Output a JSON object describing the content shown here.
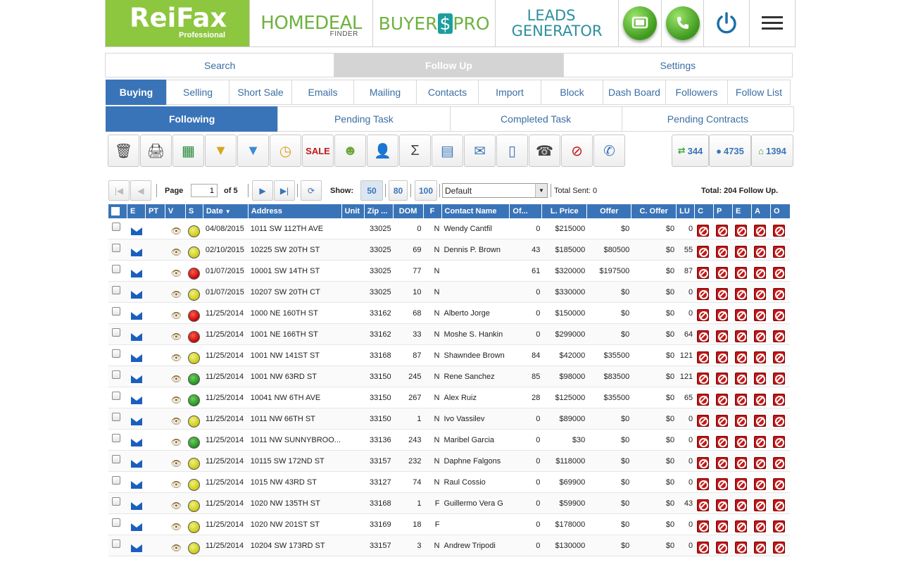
{
  "header": {
    "logo_brand": "ReiFax",
    "logo_sub": "Professional",
    "homedeal": "HOMEDEAL",
    "homedeal_sub": "FINDER",
    "buyerspro_a": "BUYER",
    "buyerspro_s": "$",
    "buyerspro_b": "PRO",
    "leads_1": "LEADS",
    "leads_2": "GENERATOR"
  },
  "main_tabs": [
    "Search",
    "Follow Up",
    "Settings"
  ],
  "sub_tabs": [
    "Buying",
    "Selling",
    "Short Sale",
    "Emails",
    "Mailing",
    "Contacts",
    "Import",
    "Block",
    "Dash Board",
    "Followers",
    "Follow List"
  ],
  "task_tabs": [
    "Following",
    "Pending Task",
    "Completed Task",
    "Pending Contracts"
  ],
  "stats": {
    "a": "344",
    "b": "4735",
    "c": "1394"
  },
  "pager": {
    "page_label": "Page",
    "page_value": "1",
    "of_label": "of 5",
    "show_label": "Show:",
    "show_options": [
      "50",
      "80",
      "100"
    ],
    "filter_value": "Default",
    "total_sent": "Total Sent: 0",
    "total": "Total: 204 Follow Up."
  },
  "columns": [
    "E",
    "PT",
    "V",
    "S",
    "Date",
    "Address",
    "Unit",
    "Zip ...",
    "DOM",
    "F",
    "Contact Name",
    "Of...",
    "L. Price",
    "Offer",
    "C. Offer",
    "LU",
    "C",
    "P",
    "E",
    "A",
    "O"
  ],
  "rows": [
    {
      "status": "yellow",
      "date": "04/08/2015",
      "address": "1011 SW 112TH AVE",
      "unit": "",
      "zip": "33025",
      "dom": "0",
      "f": "N",
      "contact": "Wendy Cantfil",
      "of": "0",
      "lprice": "$215000",
      "offer": "$0",
      "coffer": "$0",
      "lu": "0"
    },
    {
      "status": "yellow",
      "date": "02/10/2015",
      "address": "10225 SW 20TH ST",
      "unit": "",
      "zip": "33025",
      "dom": "69",
      "f": "N",
      "contact": "Dennis P. Brown",
      "of": "43",
      "lprice": "$185000",
      "offer": "$80500",
      "coffer": "$0",
      "lu": "55"
    },
    {
      "status": "red",
      "date": "01/07/2015",
      "address": "10001 SW 14TH ST",
      "unit": "",
      "zip": "33025",
      "dom": "77",
      "f": "N",
      "contact": "",
      "of": "61",
      "lprice": "$320000",
      "offer": "$197500",
      "coffer": "$0",
      "lu": "87"
    },
    {
      "status": "yellow",
      "date": "01/07/2015",
      "address": "10207 SW 20TH CT",
      "unit": "",
      "zip": "33025",
      "dom": "10",
      "f": "N",
      "contact": "",
      "of": "0",
      "lprice": "$330000",
      "offer": "$0",
      "coffer": "$0",
      "lu": "0"
    },
    {
      "status": "red",
      "date": "11/25/2014",
      "address": "1000 NE 160TH ST",
      "unit": "",
      "zip": "33162",
      "dom": "68",
      "f": "N",
      "contact": "Alberto Jorge",
      "of": "0",
      "lprice": "$150000",
      "offer": "$0",
      "coffer": "$0",
      "lu": "0"
    },
    {
      "status": "red",
      "date": "11/25/2014",
      "address": "1001 NE 166TH ST",
      "unit": "",
      "zip": "33162",
      "dom": "33",
      "f": "N",
      "contact": "Moshe S. Hankin",
      "of": "0",
      "lprice": "$299000",
      "offer": "$0",
      "coffer": "$0",
      "lu": "64"
    },
    {
      "status": "yellow",
      "date": "11/25/2014",
      "address": "1001 NW 141ST ST",
      "unit": "",
      "zip": "33168",
      "dom": "87",
      "f": "N",
      "contact": "Shawndee Brown",
      "of": "84",
      "lprice": "$42000",
      "offer": "$35500",
      "coffer": "$0",
      "lu": "121"
    },
    {
      "status": "green",
      "date": "11/25/2014",
      "address": "1001 NW 63RD ST",
      "unit": "",
      "zip": "33150",
      "dom": "245",
      "f": "N",
      "contact": "Rene Sanchez",
      "of": "85",
      "lprice": "$98000",
      "offer": "$83500",
      "coffer": "$0",
      "lu": "121"
    },
    {
      "status": "green",
      "date": "11/25/2014",
      "address": "10041 NW 6TH AVE",
      "unit": "",
      "zip": "33150",
      "dom": "267",
      "f": "N",
      "contact": "Alex Ruiz",
      "of": "28",
      "lprice": "$125000",
      "offer": "$35500",
      "coffer": "$0",
      "lu": "65"
    },
    {
      "status": "yellow",
      "date": "11/25/2014",
      "address": "1011 NW 66TH ST",
      "unit": "",
      "zip": "33150",
      "dom": "1",
      "f": "N",
      "contact": "Ivo Vassilev",
      "of": "0",
      "lprice": "$89000",
      "offer": "$0",
      "coffer": "$0",
      "lu": "0"
    },
    {
      "status": "green",
      "date": "11/25/2014",
      "address": "1011 NW SUNNYBROO...",
      "unit": "",
      "zip": "33136",
      "dom": "243",
      "f": "N",
      "contact": "Maribel Garcia",
      "of": "0",
      "lprice": "$30",
      "offer": "$0",
      "coffer": "$0",
      "lu": "0"
    },
    {
      "status": "yellow",
      "date": "11/25/2014",
      "address": "10115 SW 172ND ST",
      "unit": "",
      "zip": "33157",
      "dom": "232",
      "f": "N",
      "contact": "Daphne Falgons",
      "of": "0",
      "lprice": "$118000",
      "offer": "$0",
      "coffer": "$0",
      "lu": "0"
    },
    {
      "status": "yellow",
      "date": "11/25/2014",
      "address": "1015 NW 43RD ST",
      "unit": "",
      "zip": "33127",
      "dom": "74",
      "f": "N",
      "contact": "Raul Cossio",
      "of": "0",
      "lprice": "$69900",
      "offer": "$0",
      "coffer": "$0",
      "lu": "0"
    },
    {
      "status": "yellow",
      "date": "11/25/2014",
      "address": "1020 NW 135TH ST",
      "unit": "",
      "zip": "33168",
      "dom": "1",
      "f": "F",
      "contact": "Guillermo Vera G",
      "of": "0",
      "lprice": "$59900",
      "offer": "$0",
      "coffer": "$0",
      "lu": "43"
    },
    {
      "status": "yellow",
      "date": "11/25/2014",
      "address": "1020 NW 201ST ST",
      "unit": "",
      "zip": "33169",
      "dom": "18",
      "f": "F",
      "contact": "",
      "of": "0",
      "lprice": "$178000",
      "offer": "$0",
      "coffer": "$0",
      "lu": "0"
    },
    {
      "status": "yellow",
      "date": "11/25/2014",
      "address": "10204 SW 173RD ST",
      "unit": "",
      "zip": "33157",
      "dom": "3",
      "f": "N",
      "contact": "Andrew Tripodi",
      "of": "0",
      "lprice": "$130000",
      "offer": "$0",
      "coffer": "$0",
      "lu": "0"
    }
  ]
}
